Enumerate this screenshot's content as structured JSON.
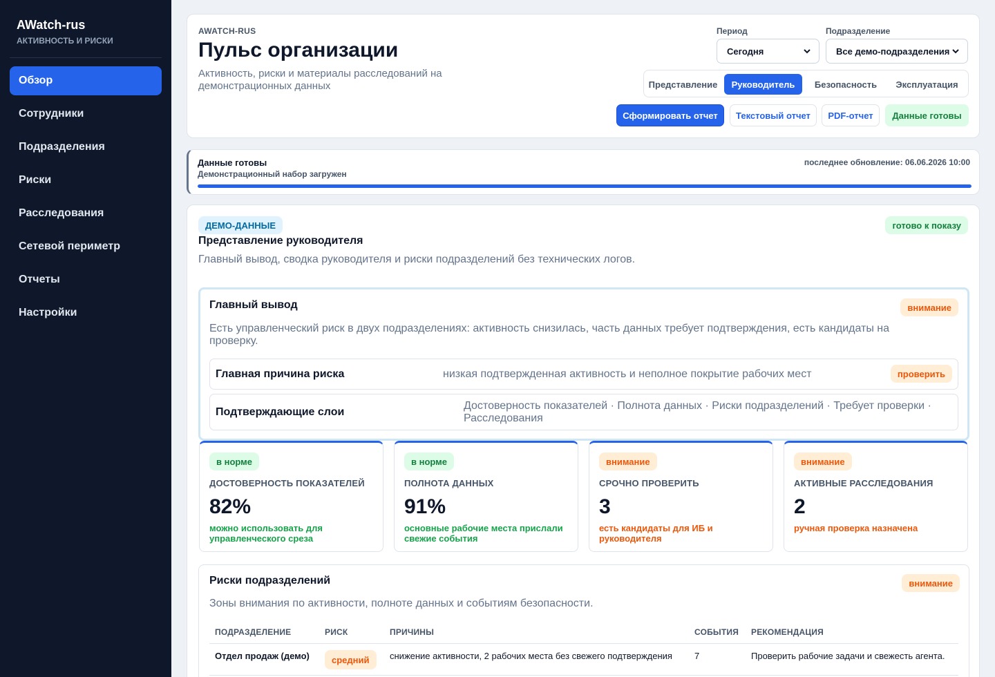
{
  "sidebar": {
    "title": "AWatch-rus",
    "subtitle": "АКТИВНОСТЬ И РИСКИ",
    "items": [
      {
        "label": "Обзор"
      },
      {
        "label": "Сотрудники"
      },
      {
        "label": "Подразделения"
      },
      {
        "label": "Риски"
      },
      {
        "label": "Расследования"
      },
      {
        "label": "Сетевой периметр"
      },
      {
        "label": "Отчеты"
      },
      {
        "label": "Настройки"
      }
    ],
    "active_index": 0
  },
  "header": {
    "kicker": "AWATCH-RUS",
    "title": "Пульс организации",
    "description": "Активность, риски и материалы расследований на демонстрационных данных",
    "period_label": "Период",
    "period_value": "Сегодня",
    "division_label": "Подразделение",
    "division_value": "Все демо-подразделения",
    "views": [
      {
        "label": "Представление"
      },
      {
        "label": "Руководитель"
      },
      {
        "label": "Безопасность"
      },
      {
        "label": "Эксплуатация"
      }
    ],
    "active_view": "Руководитель",
    "actions": {
      "generate": "Сформировать отчет",
      "text_report": "Текстовый отчет",
      "pdf_report": "PDF-отчет",
      "data_ready": "Данные готовы"
    }
  },
  "status": {
    "title": "Данные готовы",
    "subtitle": "Демонстрационный набор загружен",
    "updated": "последнее обновление: 06.06.2026 10:00",
    "progress": 1.0
  },
  "main": {
    "tag": "ДЕМО-ДАННЫЕ",
    "ready_badge": "готово к показу",
    "title": "Представление руководителя",
    "description": "Главный вывод, сводка руководителя и риски подразделений без технических логов.",
    "conclusion": {
      "title": "Главный вывод",
      "badge": "внимание",
      "text": "Есть управленческий риск в двух подразделениях: активность снизилась, часть данных требует подтверждения, есть кандидаты на проверку.",
      "cause_label": "Главная причина риска",
      "cause_value": "низкая подтвержденная активность и неполное покрытие рабочих мест",
      "cause_badge": "проверить",
      "layers_label": "Подтверждающие слои",
      "layers_value": "Достоверность показателей · Полнота данных · Риски подразделений · Требует проверки · Расследования"
    },
    "kpis": [
      {
        "badge": "в норме",
        "label": "ДОСТОВЕРНОСТЬ ПОКАЗАТЕЛЕЙ",
        "value": "82%",
        "note": "можно использовать для управленческого среза"
      },
      {
        "badge": "в норме",
        "label": "ПОЛНОТА ДАННЫХ",
        "value": "91%",
        "note": "основные рабочие места прислали свежие события"
      },
      {
        "badge": "внимание",
        "label": "СРОЧНО ПРОВЕРИТЬ",
        "value": "3",
        "note": "есть кандидаты для ИБ и руководителя"
      },
      {
        "badge": "внимание",
        "label": "АКТИВНЫЕ РАССЛЕДОВАНИЯ",
        "value": "2",
        "note": "ручная проверка назначена"
      }
    ],
    "risks": {
      "title": "Риски подразделений",
      "badge": "внимание",
      "description": "Зоны внимания по активности, полноте данных и событиям безопасности.",
      "columns": [
        "ПОДРАЗДЕЛЕНИЕ",
        "РИСК",
        "ПРИЧИНЫ",
        "СОБЫТИЯ",
        "РЕКОМЕНДАЦИЯ"
      ],
      "rows": [
        {
          "division": "Отдел продаж (демо)",
          "risk": "средний",
          "reasons": "снижение активности, 2 рабочих места без свежего подтверждения",
          "events": "7",
          "recommendation": "Проверить рабочие задачи и свежесть агента."
        }
      ]
    }
  },
  "colors": {
    "sidebar_bg": "#0f172a",
    "accent": "#2563eb",
    "ok": "#16a34a",
    "warn": "#ea580c",
    "info": "#0369a1"
  }
}
